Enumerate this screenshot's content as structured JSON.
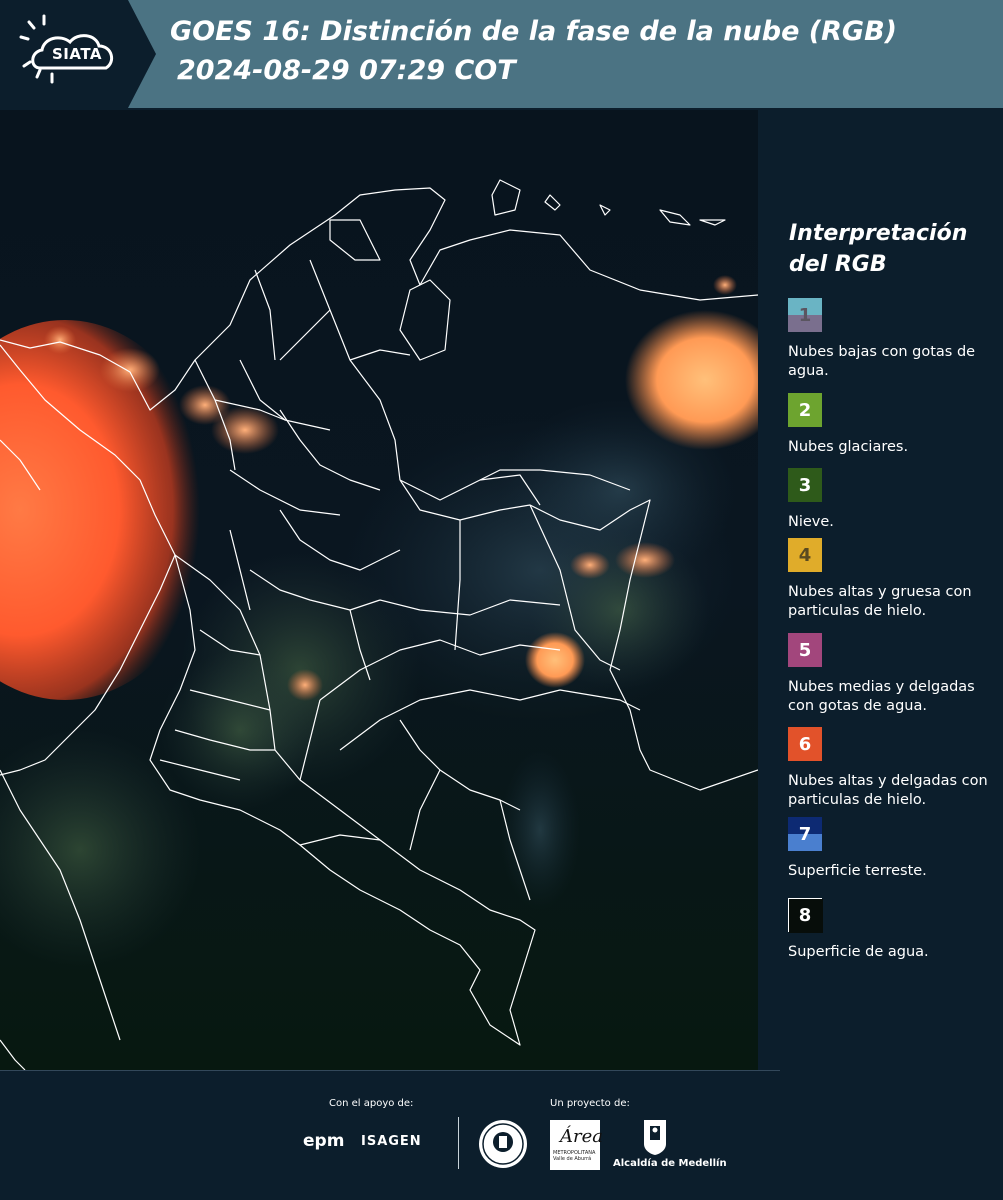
{
  "header": {
    "logo_text": "SIATA",
    "title_line1": "GOES 16: Distinción de la fase de la nube (RGB)",
    "title_line2": "2024-08-29 07:29 COT"
  },
  "legend": {
    "title": "Interpretación del RGB",
    "items": [
      {
        "number": "1",
        "label": "Nubes bajas con gotas de agua.",
        "color_top": "#6ab4c4",
        "color_bottom": "#7a6f8e",
        "number_color": "#5a5560"
      },
      {
        "number": "2",
        "label": "Nubes glaciares.",
        "color_top": "#6da42f",
        "color_bottom": "#6da42f",
        "number_color": "#ffffff"
      },
      {
        "number": "3",
        "label": "Nieve.",
        "color_top": "#2e5a1a",
        "color_bottom": "#2e5a1a",
        "number_color": "#ffffff"
      },
      {
        "number": "4",
        "label": "Nubes altas y gruesa con particulas de hielo.",
        "color_top": "#e0ac2a",
        "color_bottom": "#e0ac2a",
        "number_color": "#5a4a20"
      },
      {
        "number": "5",
        "label": "Nubes medias y delgadas con gotas de agua.",
        "color_top": "#a2467c",
        "color_bottom": "#a2467c",
        "number_color": "#ffffff"
      },
      {
        "number": "6",
        "label": "Nubes altas y delgadas con particulas de hielo.",
        "color_top": "#e2522a",
        "color_bottom": "#e2522a",
        "number_color": "#ffffff"
      },
      {
        "number": "7",
        "label": "Superficie terreste.",
        "color_top": "#0d2a73",
        "color_bottom": "#4a7fcf",
        "number_color": "#ffffff"
      },
      {
        "number": "8",
        "label": "Superficie de agua.",
        "color_top": "#070d0a",
        "color_bottom": "#070d0a",
        "number_color": "#ffffff"
      }
    ]
  },
  "footer": {
    "support_label": "Con el apoyo de:",
    "project_label": "Un proyecto de:",
    "sponsor_epm": "epm",
    "sponsor_isagen": "ISAGEN",
    "amva_script": "Área",
    "amva_text": "METROPOLITANA Valle de Aburrá",
    "alcaldia": "Alcaldía de Medellín"
  }
}
